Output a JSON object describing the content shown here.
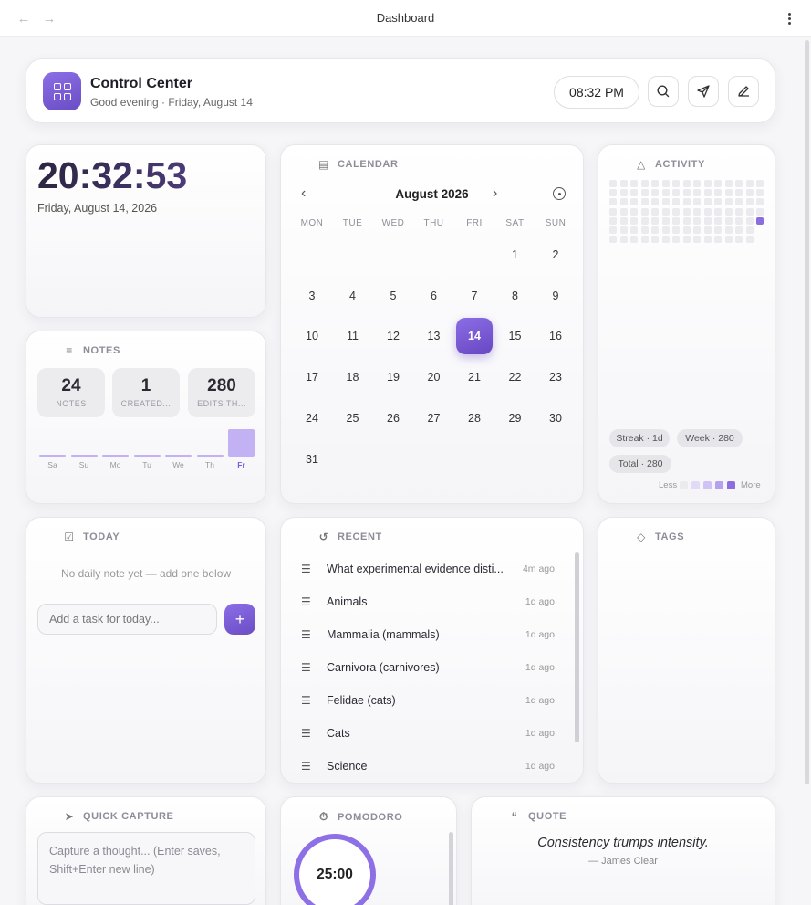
{
  "window": {
    "title": "Dashboard"
  },
  "header": {
    "title": "Control Center",
    "subtitle": "Good evening · Friday, August 14",
    "time": "08:32 PM"
  },
  "clock": {
    "time": "20:32:53",
    "date": "Friday, August 14, 2026"
  },
  "notes": {
    "title": "NOTES",
    "stats": [
      {
        "value": "24",
        "label": "NOTES"
      },
      {
        "value": "1",
        "label": "CREATED..."
      },
      {
        "value": "280",
        "label": "EDITS TH..."
      }
    ],
    "days": [
      "Sa",
      "Su",
      "Mo",
      "Tu",
      "We",
      "Th",
      "Fr"
    ],
    "activity": [
      0,
      0,
      0,
      0,
      0,
      0,
      280
    ]
  },
  "calendar": {
    "title": "CALENDAR",
    "month": "August 2026",
    "weekdays": [
      "MON",
      "TUE",
      "WED",
      "THU",
      "FRI",
      "SAT",
      "SUN"
    ],
    "days": [
      "1",
      "2",
      "3",
      "4",
      "5",
      "6",
      "7",
      "8",
      "9",
      "10",
      "11",
      "12",
      "13",
      "14",
      "15",
      "16",
      "17",
      "18",
      "19",
      "20",
      "21",
      "22",
      "23",
      "24",
      "25",
      "26",
      "27",
      "28",
      "29",
      "30",
      "31"
    ],
    "first_weekday_index": 5,
    "today": "14"
  },
  "activity": {
    "title": "ACTIVITY",
    "chips": [
      "Streak · 1d",
      "Week · 280",
      "Total · 280"
    ],
    "legend_less": "Less",
    "legend_more": "More",
    "colors": {
      "empty": "#ebebef",
      "level1": "#e2dbf8",
      "level2": "#cfc2f5",
      "level3": "#b6a1ee",
      "level4": "#8b6de0"
    }
  },
  "tags": {
    "title": "TAGS"
  },
  "today": {
    "title": "TODAY",
    "empty_text": "No daily note yet — add one below",
    "input_placeholder": "Add a task for today..."
  },
  "recent": {
    "title": "RECENT",
    "items": [
      {
        "title": "What experimental evidence disti...",
        "age": "4m ago"
      },
      {
        "title": "Animals",
        "age": "1d ago"
      },
      {
        "title": "Mammalia (mammals)",
        "age": "1d ago"
      },
      {
        "title": "Carnivora (carnivores)",
        "age": "1d ago"
      },
      {
        "title": "Felidae (cats)",
        "age": "1d ago"
      },
      {
        "title": "Cats",
        "age": "1d ago"
      },
      {
        "title": "Science",
        "age": "1d ago"
      }
    ]
  },
  "capture": {
    "title": "QUICK CAPTURE",
    "placeholder": "Capture a thought... (Enter saves, Shift+Enter new line)"
  },
  "pomodoro": {
    "title": "POMODORO",
    "time": "25:00"
  },
  "quote": {
    "title": "QUOTE",
    "text": "Consistency trumps intensity.",
    "author": "— James Clear"
  },
  "accent": "#7a5bd8"
}
